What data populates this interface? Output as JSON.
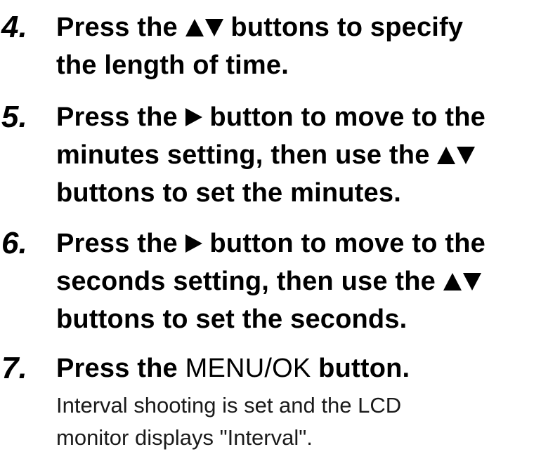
{
  "steps": [
    {
      "number": "4.",
      "lines": [
        {
          "before": "Press the ",
          "icons": [
            "up",
            "down"
          ],
          "after": " buttons to specify"
        },
        {
          "before": "the length of time."
        }
      ]
    },
    {
      "number": "5.",
      "lines": [
        {
          "before": "Press the ",
          "icons": [
            "right"
          ],
          "after": " button to move to the"
        },
        {
          "before": "minutes setting, then use the ",
          "icons": [
            "up",
            "down"
          ]
        },
        {
          "before": "buttons to set the minutes."
        }
      ]
    },
    {
      "number": "6.",
      "lines": [
        {
          "before": "Press the ",
          "icons": [
            "right"
          ],
          "after": " button to move to the"
        },
        {
          "before": "seconds setting, then use the ",
          "icons": [
            "up",
            "down"
          ]
        },
        {
          "before": "buttons to set the seconds."
        }
      ]
    },
    {
      "number": "7.",
      "lines": [
        {
          "before": "Press the ",
          "menu": "MENU/OK",
          "after": " button."
        }
      ]
    }
  ],
  "note_lines": [
    "Interval shooting is set and the LCD",
    "monitor displays \"Interval\"."
  ],
  "icons": {
    "up": "up-triangle-icon",
    "down": "down-triangle-icon",
    "right": "right-triangle-icon"
  }
}
